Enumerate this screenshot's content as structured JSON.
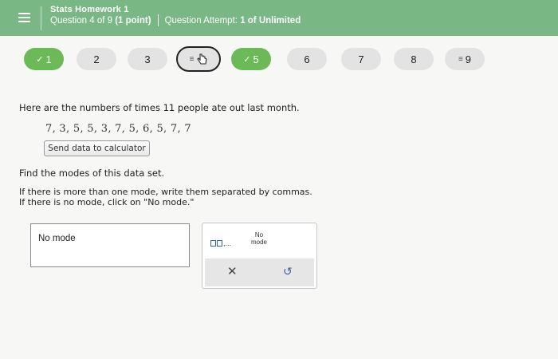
{
  "header": {
    "homework_title": "Stats Homework 1",
    "question_label": "Question 4 of 9",
    "points": "(1 point)",
    "attempt_label": "Question Attempt:",
    "attempt_value": "1 of Unlimited",
    "menu_icon": "hamburger-menu-icon"
  },
  "nav": {
    "items": [
      {
        "label": "1",
        "status": "correct",
        "icon": "check-icon"
      },
      {
        "label": "2",
        "status": "unanswered"
      },
      {
        "label": "3",
        "status": "unanswered"
      },
      {
        "label": "",
        "status": "current-partial",
        "icon": "cursor-hand-icon"
      },
      {
        "label": "5",
        "status": "correct",
        "icon": "check-icon"
      },
      {
        "label": "6",
        "status": "unanswered"
      },
      {
        "label": "7",
        "status": "unanswered"
      },
      {
        "label": "8",
        "status": "unanswered"
      },
      {
        "label": "9",
        "status": "partial",
        "icon": "partial-icon"
      }
    ],
    "check_glyph": "✓",
    "partial_glyph": "≡"
  },
  "problem": {
    "intro": "Here are the numbers of times 11 people ate out last month.",
    "data": "7, 3, 5, 5, 3, 7, 5, 6, 5, 7, 7",
    "send_button": "Send data to calculator",
    "question": "Find the modes of this data set.",
    "instruction_line1": "If there is more than one mode, write them separated by commas.",
    "instruction_line2": "If there is no mode, click on \"No mode.\""
  },
  "answer": {
    "value": "No mode"
  },
  "keypad": {
    "comma_key": "comma-separated-list-icon",
    "no_mode_line1": "No",
    "no_mode_line2": "mode",
    "clear_glyph": "✕",
    "undo_glyph": "↻"
  },
  "colors": {
    "header_bg": "#79b785",
    "correct_green": "#6cba57",
    "undo_blue": "#3a5ea8"
  }
}
